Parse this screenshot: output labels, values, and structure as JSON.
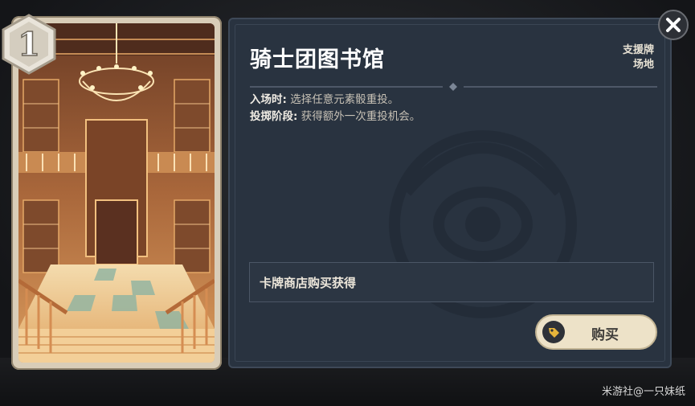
{
  "card": {
    "cost": "1",
    "art_description_icon": "library-art"
  },
  "detail": {
    "title": "骑士团图书馆",
    "tags": [
      "支援牌",
      "场地"
    ],
    "effects": [
      {
        "label": "入场时:",
        "text": " 选择任意元素骰重投。"
      },
      {
        "label": "投掷阶段:",
        "text": " 获得额外一次重投机会。"
      }
    ],
    "acquisition": "卡牌商店购买获得",
    "buy_label": "购买"
  },
  "close_icon": "close-icon",
  "watermark": "米游社@一只妹纸",
  "colors": {
    "panel_bg": "#293340",
    "buy_bg": "#ede2c8",
    "card_frame": "#d9cdb8"
  }
}
